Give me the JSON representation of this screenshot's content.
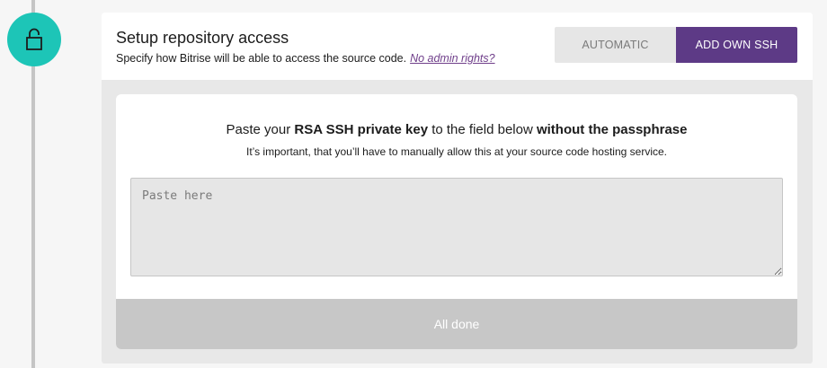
{
  "section": {
    "title": "Setup repository access",
    "subtitle": "Specify how Bitrise will be able to access the source code.",
    "help_link": "No admin rights?"
  },
  "toggle": {
    "options": [
      {
        "label": "AUTOMATIC",
        "selected": false
      },
      {
        "label": "ADD OWN SSH",
        "selected": true
      }
    ]
  },
  "instructions": {
    "part1": "Paste your ",
    "bold1": "RSA SSH private key",
    "part2": " to the field below ",
    "bold2": "without the passphrase",
    "note": "It’s important, that you’ll have to manually allow this at your source code hosting service."
  },
  "key_field": {
    "placeholder": "Paste here",
    "value": ""
  },
  "done_button": {
    "label": "All done",
    "enabled": false
  },
  "icons": {
    "step_icon": "lock-open-icon"
  },
  "colors": {
    "step_circle": "#1dc5b7",
    "accent_purple": "#5d3a86",
    "link_purple": "#6f3e8a",
    "disabled_button": "#c7c7c7"
  }
}
